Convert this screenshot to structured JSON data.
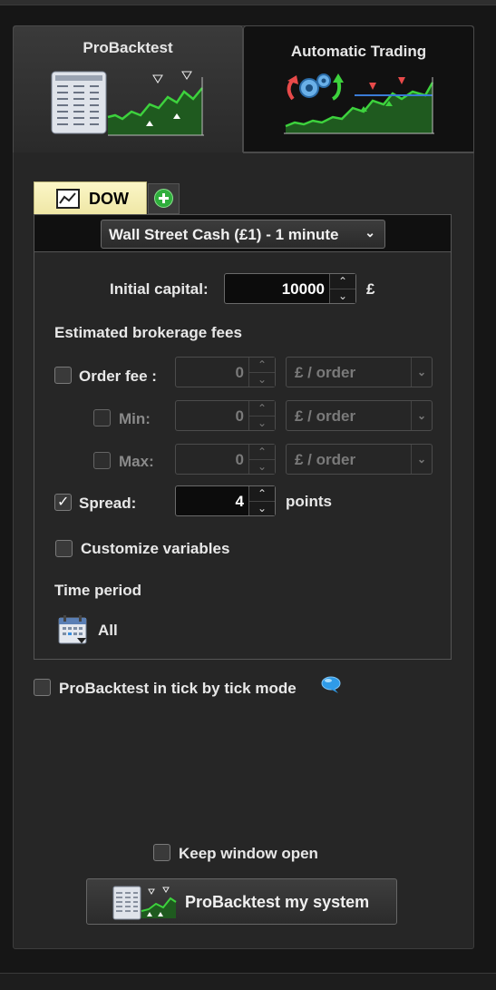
{
  "tabs": {
    "backtest_label": "ProBacktest",
    "auto_label": "Automatic Trading"
  },
  "instrument_tab": {
    "label": "DOW"
  },
  "instrument_select": {
    "label": "Wall Street Cash (£1) - 1 minute"
  },
  "capital": {
    "label": "Initial capital:",
    "value": "10000",
    "currency": "£"
  },
  "fees": {
    "heading": "Estimated brokerage fees",
    "order_fee": {
      "label": "Order fee :",
      "value": "0",
      "unit": "£ / order",
      "checked": false
    },
    "min": {
      "label": "Min:",
      "value": "0",
      "unit": "£ / order",
      "checked": false
    },
    "max": {
      "label": "Max:",
      "value": "0",
      "unit": "£ / order",
      "checked": false
    }
  },
  "spread": {
    "label": "Spread:",
    "value": "4",
    "unit": "points",
    "checked": true
  },
  "customize": {
    "label": "Customize variables",
    "checked": false
  },
  "time_period": {
    "heading": "Time period",
    "value": "All"
  },
  "tick_mode": {
    "label": "ProBacktest in tick by tick mode",
    "checked": false
  },
  "keep_open": {
    "label": "Keep window open",
    "checked": false
  },
  "run_button": {
    "label": "ProBacktest my system"
  },
  "colors": {
    "accent_green": "#2fae3c",
    "tab_yellow": "#fbf6c7",
    "panel_bg": "#262626"
  }
}
